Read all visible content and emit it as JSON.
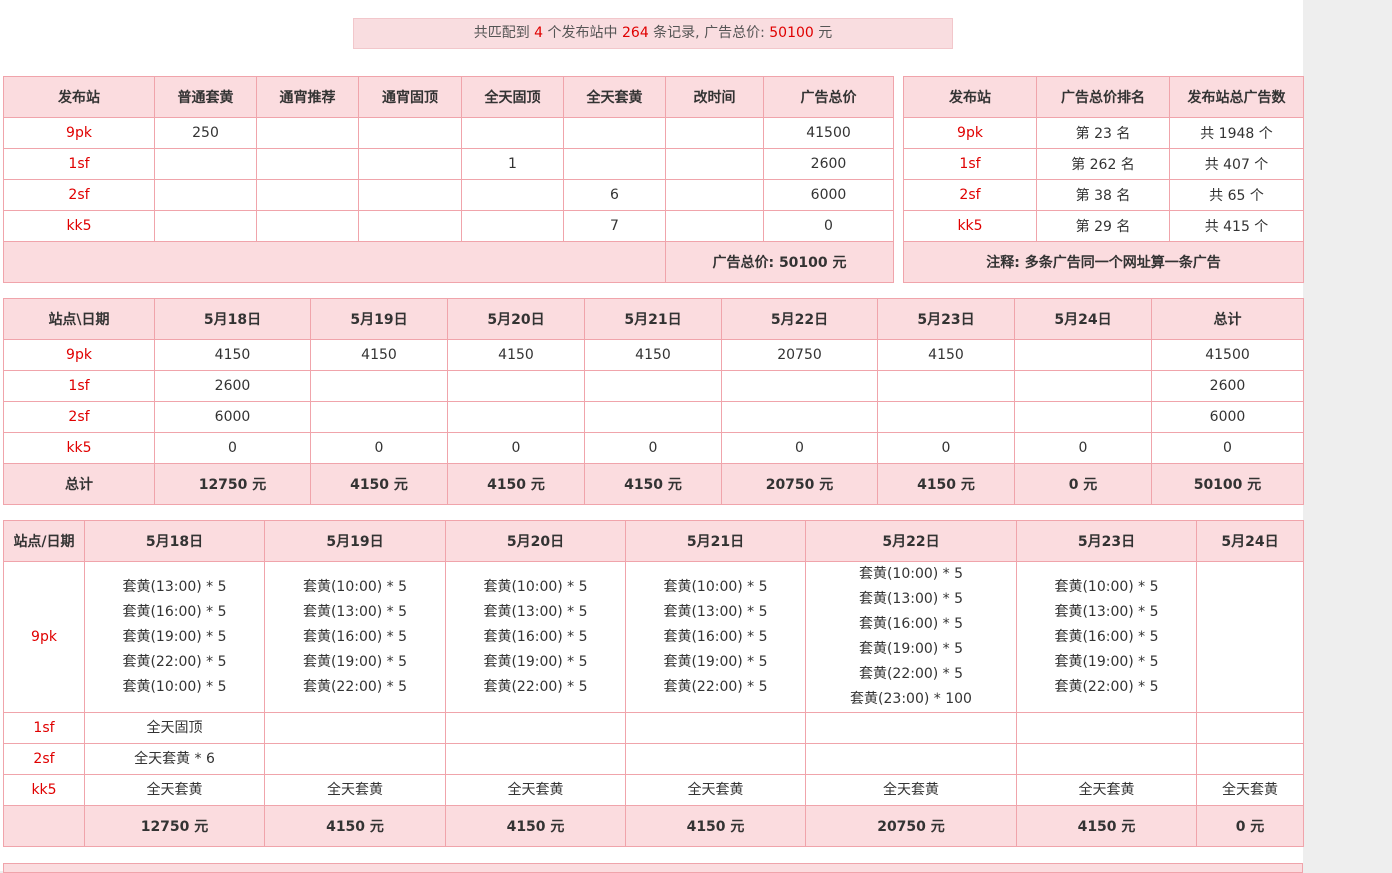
{
  "summary": {
    "p1": "共匹配到 ",
    "sites": "4",
    "p2": " 个发布站中 ",
    "records": "264",
    "p3": " 条记录, 广告总价: ",
    "price": "50100",
    "p4": " 元"
  },
  "table1": {
    "headers": [
      "发布站",
      "普通套黄",
      "通宵推荐",
      "通宵固顶",
      "全天固顶",
      "全天套黄",
      "改时间",
      "广告总价"
    ],
    "rows": [
      [
        "9pk",
        "250",
        "",
        "",
        "",
        "",
        "",
        "41500"
      ],
      [
        "1sf",
        "",
        "",
        "",
        "1",
        "",
        "",
        "2600"
      ],
      [
        "2sf",
        "",
        "",
        "",
        "",
        "6",
        "",
        "6000"
      ],
      [
        "kk5",
        "",
        "",
        "",
        "",
        "7",
        "",
        "0"
      ]
    ],
    "footer": "广告总价: 50100 元"
  },
  "table2": {
    "headers": [
      "发布站",
      "广告总价排名",
      "发布站总广告数"
    ],
    "rows": [
      [
        "9pk",
        "第 23 名",
        "共 1948 个"
      ],
      [
        "1sf",
        "第 262 名",
        "共 407 个"
      ],
      [
        "2sf",
        "第 38 名",
        "共 65 个"
      ],
      [
        "kk5",
        "第 29 名",
        "共 415 个"
      ]
    ],
    "footer": "注释: 多条广告同一个网址算一条广告"
  },
  "table3": {
    "headers": [
      "站点\\日期",
      "5月18日",
      "5月19日",
      "5月20日",
      "5月21日",
      "5月22日",
      "5月23日",
      "5月24日",
      "总计"
    ],
    "rows": [
      [
        "9pk",
        "4150",
        "4150",
        "4150",
        "4150",
        "20750",
        "4150",
        "",
        "41500"
      ],
      [
        "1sf",
        "2600",
        "",
        "",
        "",
        "",
        "",
        "",
        "2600"
      ],
      [
        "2sf",
        "6000",
        "",
        "",
        "",
        "",
        "",
        "",
        "6000"
      ],
      [
        "kk5",
        "0",
        "0",
        "0",
        "0",
        "0",
        "0",
        "0",
        "0"
      ]
    ],
    "footer": [
      "总计",
      "12750 元",
      "4150 元",
      "4150 元",
      "4150 元",
      "20750 元",
      "4150 元",
      "0 元",
      "50100 元"
    ]
  },
  "table4": {
    "headers": [
      "站点/日期",
      "5月18日",
      "5月19日",
      "5月20日",
      "5月21日",
      "5月22日",
      "5月23日",
      "5月24日"
    ],
    "rows": [
      [
        "9pk",
        [
          "套黄(13:00) * 5",
          "套黄(16:00) * 5",
          "套黄(19:00) * 5",
          "套黄(22:00) * 5",
          "套黄(10:00) * 5"
        ],
        [
          "套黄(10:00) * 5",
          "套黄(13:00) * 5",
          "套黄(16:00) * 5",
          "套黄(19:00) * 5",
          "套黄(22:00) * 5"
        ],
        [
          "套黄(10:00) * 5",
          "套黄(13:00) * 5",
          "套黄(16:00) * 5",
          "套黄(19:00) * 5",
          "套黄(22:00) * 5"
        ],
        [
          "套黄(10:00) * 5",
          "套黄(13:00) * 5",
          "套黄(16:00) * 5",
          "套黄(19:00) * 5",
          "套黄(22:00) * 5"
        ],
        [
          "套黄(10:00) * 5",
          "套黄(13:00) * 5",
          "套黄(16:00) * 5",
          "套黄(19:00) * 5",
          "套黄(22:00) * 5",
          "套黄(23:00) * 100"
        ],
        [
          "套黄(10:00) * 5",
          "套黄(13:00) * 5",
          "套黄(16:00) * 5",
          "套黄(19:00) * 5",
          "套黄(22:00) * 5"
        ],
        []
      ],
      [
        "1sf",
        [
          "全天固顶"
        ],
        [],
        [],
        [],
        [],
        [],
        []
      ],
      [
        "2sf",
        [
          "全天套黄 * 6"
        ],
        [],
        [],
        [],
        [],
        [],
        []
      ],
      [
        "kk5",
        [
          "全天套黄"
        ],
        [
          "全天套黄"
        ],
        [
          "全天套黄"
        ],
        [
          "全天套黄"
        ],
        [
          "全天套黄"
        ],
        [
          "全天套黄"
        ],
        [
          "全天套黄"
        ]
      ]
    ],
    "footer": [
      "",
      "12750 元",
      "4150 元",
      "4150 元",
      "4150 元",
      "20750 元",
      "4150 元",
      "0 元"
    ]
  }
}
